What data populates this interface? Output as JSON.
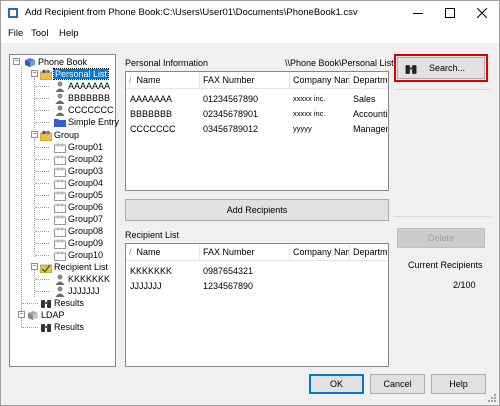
{
  "window": {
    "title_prefix": "Add Recipient from Phone Book:C:\\Users\\",
    "title_user": "User01",
    "title_suffix": "\\Documents\\PhoneBook1.csv"
  },
  "menu": [
    {
      "label": "File",
      "key": "e"
    },
    {
      "label": "Tool",
      "key": "T"
    },
    {
      "label": "Help",
      "key": "H"
    }
  ],
  "tree": {
    "phone_book": "Phone Book",
    "personal_list": "Personal List",
    "entries": [
      "AAAAAAA",
      "BBBBBBB",
      "CCCCCCC"
    ],
    "simple_entry": "Simple Entry",
    "group": "Group",
    "groups": [
      "Group01",
      "Group02",
      "Group03",
      "Group04",
      "Group05",
      "Group06",
      "Group07",
      "Group08",
      "Group09",
      "Group10"
    ],
    "recipient_list": "Recipient List",
    "recipients": [
      "KKKKKKK",
      "JJJJJJJ"
    ],
    "results": "Results",
    "ldap": "LDAP",
    "ldap_results": "Results"
  },
  "personal_info": {
    "label": "Personal Information",
    "path": "\\\\Phone Book\\Personal List",
    "sort_glyph": "/",
    "columns": [
      "Name",
      "FAX Number",
      "Company Name",
      "Department"
    ],
    "rows": [
      [
        "AAAAAAA",
        "01234567890",
        "xxxxx inc.",
        "Sales"
      ],
      [
        "BBBBBBB",
        "02345678901",
        "xxxxx inc.",
        "Accounting"
      ],
      [
        "CCCCCCC",
        "03456789012",
        "yyyyy",
        "Management"
      ]
    ]
  },
  "buttons": {
    "search": "Search...",
    "add_recipients": "Add Recipients",
    "delete": "Delete",
    "ok": "OK",
    "cancel": "Cancel",
    "help": "Help"
  },
  "recipient_list": {
    "label": "Recipient List",
    "sort_glyph": "/",
    "columns": [
      "Name",
      "FAX Number",
      "Company Name",
      "Department"
    ],
    "rows": [
      [
        "KKKKKKK",
        "0987654321",
        "",
        ""
      ],
      [
        "JJJJJJJ",
        "1234567890",
        "",
        ""
      ]
    ]
  },
  "current_recipients": {
    "label": "Current Recipients",
    "value": "2/100"
  },
  "colors": {
    "selection": "#0078d7",
    "highlight_frame": "#e00000",
    "close_glyph": "#000000"
  }
}
